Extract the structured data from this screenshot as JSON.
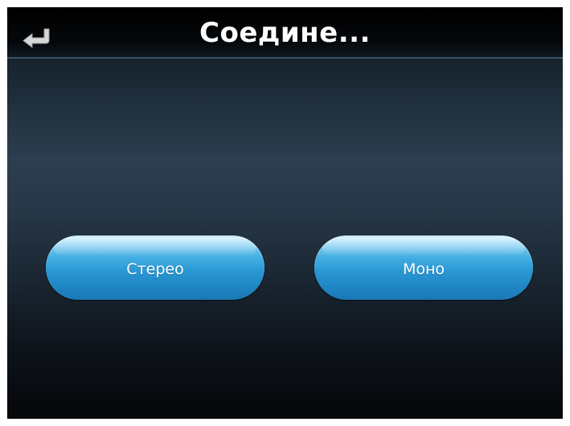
{
  "header": {
    "title": "Соедине...",
    "back_icon": "return-arrow-icon"
  },
  "buttons": {
    "stereo_label": "Стерео",
    "mono_label": "Моно"
  },
  "colors": {
    "button_accent": "#2a98d4",
    "header_background": "#000000",
    "screen_background": "#1e2d3a",
    "text": "#ffffff"
  }
}
